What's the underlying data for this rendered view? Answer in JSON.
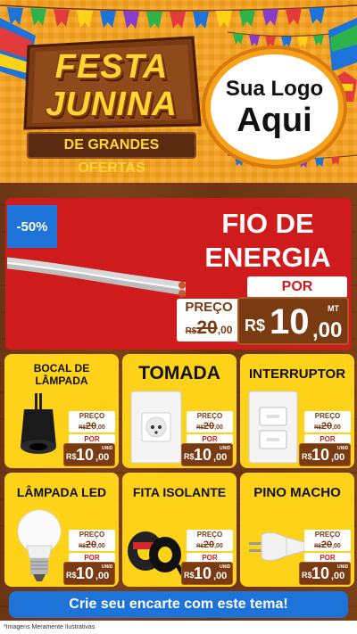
{
  "header": {
    "title_line1": "FESTA",
    "title_line2": "JUNINA",
    "title_sub": "DE GRANDES OFERTAS",
    "logo_line1": "Sua Logo",
    "logo_line2": "Aqui"
  },
  "hero": {
    "discount": "-50%",
    "title_line1": "FIO DE",
    "title_line2": "ENERGIA",
    "por_label": "POR",
    "preco_label": "PREÇO",
    "old_currency": "R$",
    "old_int": "20",
    "old_dec": ",00",
    "currency": "R$",
    "price_int": "10",
    "price_dec": ",00",
    "unit": "MT"
  },
  "products": [
    {
      "name": "BOCAL DE LÂMPADA",
      "preco_label": "PREÇO",
      "old_currency": "R$",
      "old_int": "20",
      "old_dec": ",00",
      "por_label": "POR",
      "currency": "R$",
      "price_int": "10",
      "price_dec": ",00",
      "unit": "UNID"
    },
    {
      "name": "TOMADA",
      "preco_label": "PREÇO",
      "old_currency": "R$",
      "old_int": "20",
      "old_dec": ",00",
      "por_label": "POR",
      "currency": "R$",
      "price_int": "10",
      "price_dec": ",00",
      "unit": "UNID"
    },
    {
      "name": "INTERRUPTOR",
      "preco_label": "PREÇO",
      "old_currency": "R$",
      "old_int": "20",
      "old_dec": ",00",
      "por_label": "POR",
      "currency": "R$",
      "price_int": "10",
      "price_dec": ",00",
      "unit": "UNID"
    },
    {
      "name": "LÂMPADA LED",
      "preco_label": "PREÇO",
      "old_currency": "R$",
      "old_int": "20",
      "old_dec": ",00",
      "por_label": "POR",
      "currency": "R$",
      "price_int": "10",
      "price_dec": ",00",
      "unit": "UNID"
    },
    {
      "name": "FITA ISOLANTE",
      "preco_label": "PREÇO",
      "old_currency": "R$",
      "old_int": "20",
      "old_dec": ",00",
      "por_label": "POR",
      "currency": "R$",
      "price_int": "10",
      "price_dec": ",00",
      "unit": "UNID"
    },
    {
      "name": "PINO MACHO",
      "preco_label": "PREÇO",
      "old_currency": "R$",
      "old_int": "20",
      "old_dec": ",00",
      "por_label": "POR",
      "currency": "R$",
      "price_int": "10",
      "price_dec": ",00",
      "unit": "UNID"
    }
  ],
  "cta_label": "Crie seu encarte com este tema!",
  "footer_note": "*Imagens Meramente Ilustrativas",
  "colors": {
    "header_bg": "#f7a21b",
    "wood": "#6b3515",
    "hero_red": "#cf1b1b",
    "card_yellow": "#ffd21a",
    "price_brown": "#7a3a12",
    "accent_blue": "#1e73d8"
  }
}
